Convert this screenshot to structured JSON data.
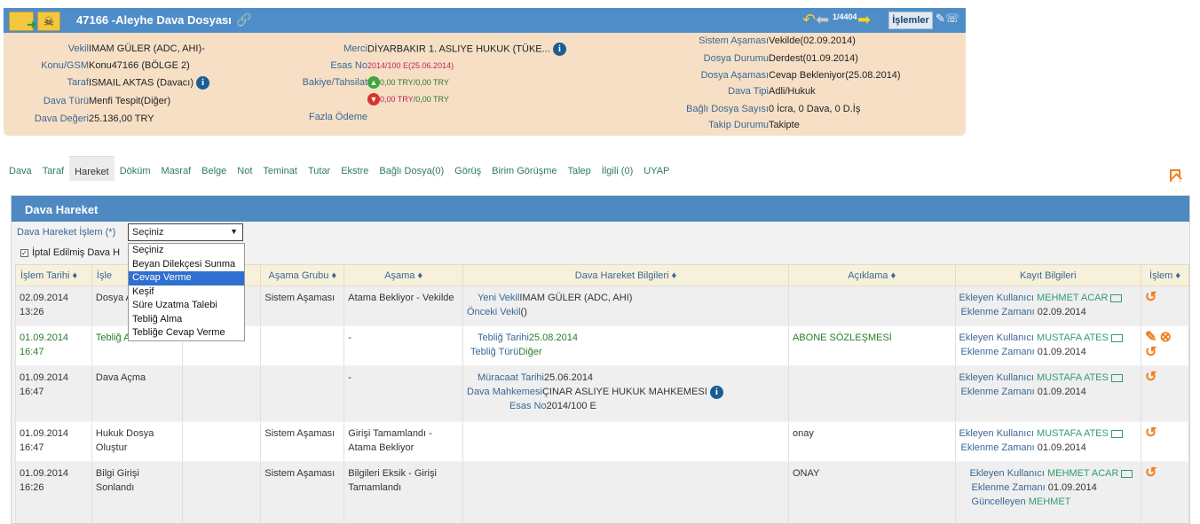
{
  "header": {
    "title": "47166 -Aleyhe Dava Dosyası",
    "nav_counter": "1/4404",
    "actions_label": "İşlemler",
    "left": [
      {
        "k": "Vekil",
        "v": "IMAM GÜLER (ADC, AHI)-"
      },
      {
        "k": "Konu/GSM",
        "v": "Konu47166 (BÖLGE 2)"
      },
      {
        "k": "Taraf",
        "v": "ISMAIL AKTAS (Davacı)"
      },
      {
        "k": "Dava Türü",
        "v": "Menfi Tespit(Diğer)"
      },
      {
        "k": "Dava Değeri",
        "v": "25.136,00 TRY"
      }
    ],
    "merci": {
      "k": "Merci",
      "v": "DİYARBAKIR 1. ASLIYE HUKUK (TÜKE..."
    },
    "esas_no": {
      "k": "Esas No",
      "v": "2014/100 E(25.06.2014)"
    },
    "bakiye": {
      "k": "Bakiye/Tahsilat",
      "v1a": "0,00 TRY",
      "v1b": "/0,00 TRY",
      "v2a": "0,00 TRY",
      "v2b": "/0,00 TRY"
    },
    "fazla_odeme": "Fazla Ödeme",
    "right": [
      {
        "k": "Sistem Aşaması",
        "v": "Vekilde(02.09.2014)"
      },
      {
        "k": "Dosya Durumu",
        "v": "Derdest(01.09.2014)"
      },
      {
        "k": "Dosya Aşaması",
        "v": "Cevap Bekleniyor(25.08.2014)"
      },
      {
        "k": "Dava Tipi",
        "v": "Adli/Hukuk"
      },
      {
        "k": "Bağlı Dosya Sayısı",
        "v": "0 İcra, 0 Dava, 0 D.İş"
      },
      {
        "k": "Takip Durumu",
        "v": "Takipte"
      }
    ]
  },
  "tabs": [
    "Dava",
    "Taraf",
    "Hareket",
    "Döküm",
    "Masraf",
    "Belge",
    "Not",
    "Teminat",
    "Tutar",
    "Ekstre",
    "Bağlı Dosya(0)",
    "Görüş",
    "Birim Görüşme",
    "Talep",
    "İlgili (0)",
    "UYAP"
  ],
  "panel": {
    "title": "Dava Hareket",
    "field_label": "Dava Hareket İşlem (*)",
    "select_value": "Seçiniz",
    "checkbox_label": "İptal Edilmiş Dava H",
    "options": [
      "Seçiniz",
      "Beyan Dilekçesi Sunma",
      "Cevap Verme",
      "Keşif",
      "Süre Uzatma Talebi",
      "Tebliğ Alma",
      "Tebliğe Cevap Verme"
    ],
    "columns": [
      "İşlem Tarihi ♦",
      "İşle",
      "",
      "Aşama Grubu ♦",
      "Aşama ♦",
      "Dava Hareket Bilgileri ♦",
      "Açıklama ♦",
      "Kayıt Bilgileri",
      "İşlem ♦"
    ],
    "rows": [
      {
        "date": "02.09.2014",
        "time": "13:26",
        "islem": "Dosya A",
        "grup": "Sistem Aşaması",
        "asama": "Atama Bekliyor - Vekilde",
        "info": [
          [
            "Yeni Vekil",
            "IMAM GÜLER (ADC, AHI)"
          ],
          [
            "Önceki Vekil",
            "()"
          ]
        ],
        "aciklama": "",
        "user_k": "Ekleyen Kullanıcı",
        "user": "MEHMET ACAR",
        "time_k": "Eklenme Zamanı",
        "etime": "02.09.2014"
      },
      {
        "date": "01.09.2014",
        "time": "16:47",
        "islem": "Tebliğ A",
        "grup": "",
        "asama": "-",
        "info": [
          [
            "Tebliğ Tarihi",
            "25.08.2014"
          ],
          [
            "Tebliğ Türü",
            "Diğer"
          ]
        ],
        "aciklama": "ABONE SÖZLEŞMESİ",
        "user_k": "Ekleyen Kullanıcı",
        "user": "MUSTAFA ATES",
        "time_k": "Eklenme Zamanı",
        "etime": "01.09.2014"
      },
      {
        "date": "01.09.2014",
        "time": "16:47",
        "islem": "Dava Açma",
        "grup": "",
        "asama": "-",
        "info": [
          [
            "Müracaat Tarihi",
            "25.06.2014"
          ],
          [
            "Dava Mahkemesi",
            "ÇINAR ASLIYE HUKUK MAHKEMESI"
          ],
          [
            "Esas No",
            "2014/100 E"
          ]
        ],
        "aciklama": "",
        "user_k": "Ekleyen Kullanıcı",
        "user": "MUSTAFA ATES",
        "time_k": "Eklenme Zamanı",
        "etime": "01.09.2014"
      },
      {
        "date": "01.09.2014",
        "time": "16:47",
        "islem": "Hukuk Dosya Oluştur",
        "grup": "Sistem Aşaması",
        "asama": "Girişi Tamamlandı - Atama Bekliyor",
        "info": [],
        "aciklama": "onay",
        "user_k": "Ekleyen Kullanıcı",
        "user": "MUSTAFA ATES",
        "time_k": "Eklenme Zamanı",
        "etime": "01.09.2014"
      },
      {
        "date": "01.09.2014",
        "time": "16:26",
        "islem": "Bilgi Girişi Sonlandı",
        "grup": "Sistem Aşaması",
        "asama": "Bilgileri Eksik - Girişi Tamamlandı",
        "info": [],
        "aciklama": "ONAY",
        "user_k": "Ekleyen Kullanıcı",
        "user": "MEHMET ACAR",
        "time_k": "Eklenme Zamanı",
        "etime": "01.09.2014",
        "upd_k": "Güncelleyen",
        "upd": "MEHMET"
      }
    ]
  }
}
